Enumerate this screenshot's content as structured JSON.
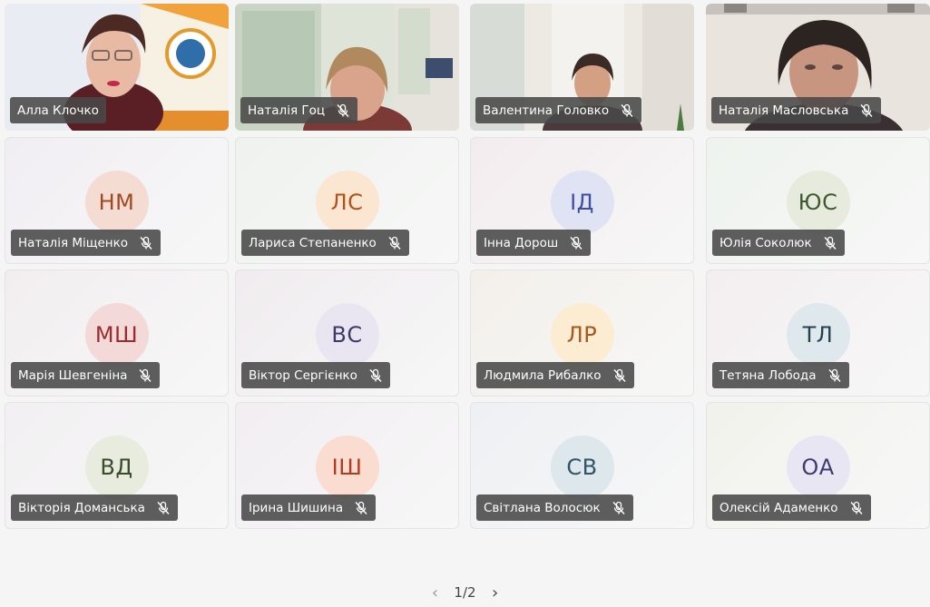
{
  "participants": [
    {
      "name": "Алла Клочко",
      "video": "presenter",
      "muted": false
    },
    {
      "name": "Наталія Гоц",
      "video": "room-window",
      "muted": true
    },
    {
      "name": "Валентина Головко",
      "video": "room-bright",
      "muted": true
    },
    {
      "name": "Наталія Масловська",
      "video": "room-wall",
      "muted": true
    },
    {
      "name": "Наталія Міщенко",
      "initials": "НМ",
      "muted": true,
      "avatar_color": "#f4dcd3",
      "text_color": "#a04a22",
      "tile_bg": "#f1eef3"
    },
    {
      "name": "Лариса Степаненко",
      "initials": "ЛС",
      "muted": true,
      "avatar_color": "#fbe6d2",
      "text_color": "#b4511a",
      "tile_bg": "#eff2ef"
    },
    {
      "name": "Інна Дорош",
      "initials": "ІД",
      "muted": true,
      "avatar_color": "#dfe3f4",
      "text_color": "#3e4fa0",
      "tile_bg": "#f3ecef"
    },
    {
      "name": "Юлія Соколюк",
      "initials": "ЮС",
      "muted": true,
      "avatar_color": "#e6ebde",
      "text_color": "#3e5a2e",
      "tile_bg": "#eef3ee"
    },
    {
      "name": "Марія Шевгеніна",
      "initials": "МШ",
      "muted": true,
      "avatar_color": "#f3d9d8",
      "text_color": "#9a2e2e",
      "tile_bg": "#f2eef0"
    },
    {
      "name": "Віктор Сергієнко",
      "initials": "ВС",
      "muted": true,
      "avatar_color": "#e9e6f2",
      "text_color": "#3d3a66",
      "tile_bg": "#f0ecef"
    },
    {
      "name": "Людмила Рибалко",
      "initials": "ЛР",
      "muted": true,
      "avatar_color": "#fbecd2",
      "text_color": "#a8581c",
      "tile_bg": "#f3f0ea"
    },
    {
      "name": "Тетяна Лобода",
      "initials": "ТЛ",
      "muted": true,
      "avatar_color": "#dfe8ec",
      "text_color": "#25404e",
      "tile_bg": "#f3eef0"
    },
    {
      "name": "Вікторія Доманська",
      "initials": "ВД",
      "muted": true,
      "avatar_color": "#e7ecde",
      "text_color": "#3b4a2a",
      "tile_bg": "#f2f0f2"
    },
    {
      "name": "Ірина Шишина",
      "initials": "ІШ",
      "muted": true,
      "avatar_color": "#fadcd1",
      "text_color": "#b33a1f",
      "tile_bg": "#f2eef2"
    },
    {
      "name": "Світлана Волосюк",
      "initials": "СВ",
      "muted": true,
      "avatar_color": "#dde7ec",
      "text_color": "#2f5566",
      "tile_bg": "#eef0f3"
    },
    {
      "name": "Олексій Адаменко",
      "initials": "ОА",
      "muted": true,
      "avatar_color": "#e8e6f2",
      "text_color": "#3f3b70",
      "tile_bg": "#f2f2ec"
    }
  ],
  "pagination": {
    "current": "1/2",
    "prev_icon": "chevron-left-icon",
    "next_icon": "chevron-right-icon"
  }
}
